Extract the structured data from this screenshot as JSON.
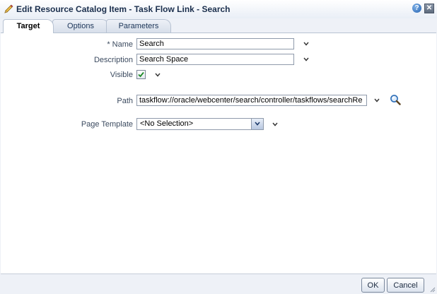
{
  "dialog": {
    "title": "Edit Resource Catalog Item - Task Flow Link - Search",
    "help_glyph": "?",
    "close_glyph": "✕"
  },
  "tabs": [
    {
      "label": "Target",
      "active": true
    },
    {
      "label": "Options",
      "active": false
    },
    {
      "label": "Parameters",
      "active": false
    }
  ],
  "form": {
    "required_marker": "*",
    "name": {
      "label": "Name",
      "value": "Search"
    },
    "description": {
      "label": "Description",
      "value": "Search Space"
    },
    "visible": {
      "label": "Visible",
      "checked": true
    },
    "path": {
      "label": "Path",
      "value": "taskflow://oracle/webcenter/search/controller/taskflows/searchRe"
    },
    "page_template": {
      "label": "Page Template",
      "selected": "<No Selection>"
    }
  },
  "footer": {
    "ok_label": "OK",
    "cancel_label": "Cancel"
  },
  "icons": {
    "title": "pencil-icon",
    "help": "help-icon",
    "close": "close-icon",
    "path_search": "magnifier-icon"
  }
}
